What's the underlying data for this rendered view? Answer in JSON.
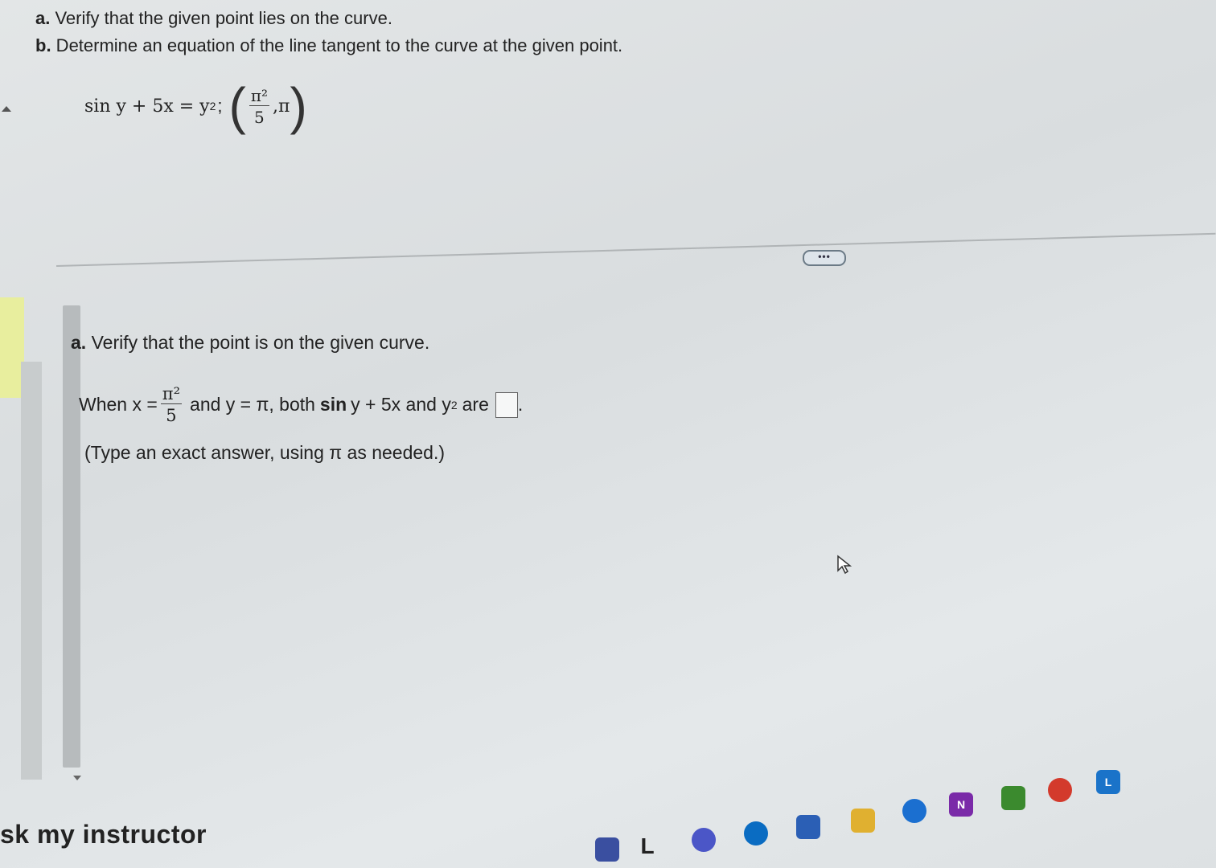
{
  "problem": {
    "part_a_letter": "a.",
    "part_a_text": " Verify that the given point lies on the curve.",
    "part_b_letter": "b.",
    "part_b_text": " Determine an equation of the line tangent to the curve at the given point."
  },
  "equation": {
    "lhs": "sin y + 5x = y",
    "exponent": "2",
    "separator": ";",
    "point_x_numerator": "π²",
    "point_x_denominator": "5",
    "point_y": ",π"
  },
  "more_button": "•••",
  "part_a": {
    "letter": "a.",
    "heading": " Verify that the point is on the given curve."
  },
  "when_line": {
    "prefix": "When x =",
    "frac_num": "π²",
    "frac_den": "5",
    "middle": "and y = π, both",
    "sin_word": "sin",
    "after_sin": "y + 5x and y",
    "exp": "2",
    "suffix": "are",
    "trailing_period": "."
  },
  "hint": "(Type an exact answer, using π as needed.)",
  "ask_instructor": "sk my instructor",
  "taskbar": {
    "onenote_letter": "N",
    "last_app_letter": "L"
  },
  "colors": {
    "edge_blue": "#0a6cc2",
    "outlook_blue": "#1b6fd0",
    "onenote_purple": "#7a2aa8",
    "minecraft_green": "#3b8a2e",
    "chrome_red": "#d33a2c",
    "letter_app_blue": "#1a73c9"
  }
}
